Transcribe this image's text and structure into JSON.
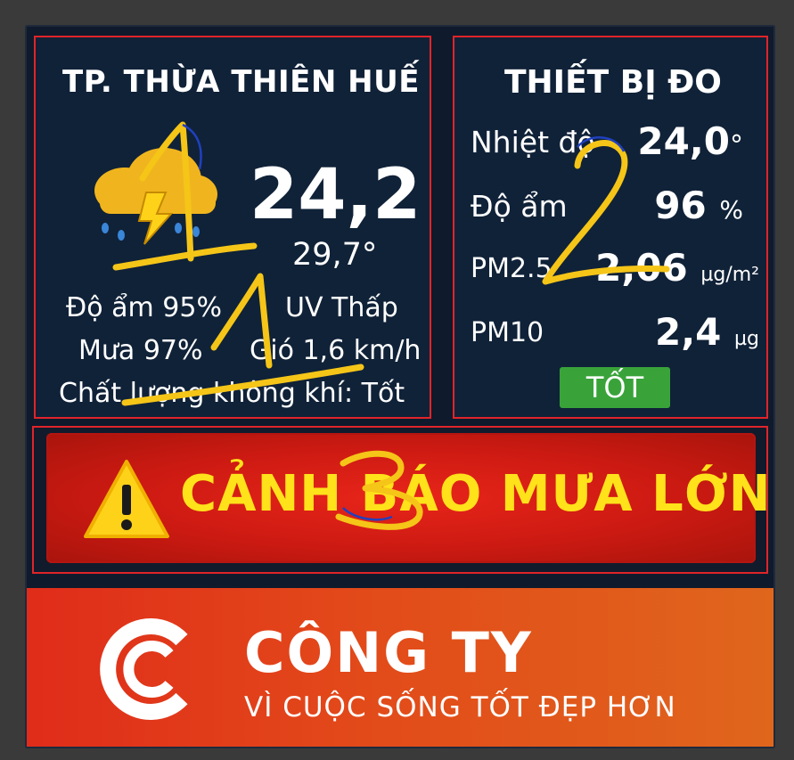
{
  "weather": {
    "city": "TP. THỪA THIÊN HUẾ",
    "icon": "thunderstorm-rain-icon",
    "temp_main": "24,2",
    "temp_feels": "29,7°",
    "humidity": "Độ ẩm 95%",
    "uv": "UV Thấp",
    "rain": "Mưa 97%",
    "wind": "Gió 1,6 km/h",
    "air_quality": "Chất lượng không khí: Tốt"
  },
  "device": {
    "title": "THIẾT BỊ ĐO",
    "rows": [
      {
        "label": "Nhiệt độ",
        "value": "24,0",
        "unit": "°"
      },
      {
        "label": "Độ ẩm",
        "value": "96",
        "unit": "%"
      },
      {
        "label": "PM2.5",
        "value": "2,06",
        "unit": "µg/m²"
      },
      {
        "label": "PM10",
        "value": "2,4",
        "unit": "µg"
      }
    ],
    "status": "TỐT",
    "status_color": "#39a33a"
  },
  "alert": {
    "icon": "warning-triangle-icon",
    "text": "CẢNH BÁO MƯA LỚN"
  },
  "company": {
    "logo": "company-c-logo",
    "name": "CÔNG TY",
    "slogan": "VÌ CUỘC SỐNG TỐT ĐẸP HƠN"
  },
  "annotations": [
    "1",
    "1",
    "2",
    "3"
  ],
  "colors": {
    "panel_border": "#e0242a",
    "alert_text": "#ffe21a",
    "annotation": "#f5c518"
  }
}
